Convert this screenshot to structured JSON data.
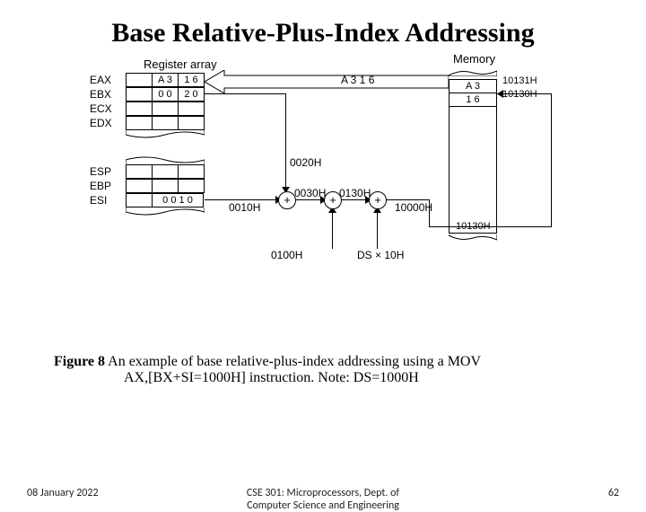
{
  "title": "Base Relative-Plus-Index Addressing",
  "diagram": {
    "register_array_label": "Register array",
    "memory_label": "Memory",
    "registers": {
      "names": [
        "EAX",
        "EBX",
        "ECX",
        "EDX",
        "ESP",
        "EBP",
        "ESI"
      ],
      "eax": [
        "A 3",
        "1 6"
      ],
      "ebx": [
        "0 0",
        "2 0"
      ],
      "esi": [
        "0 0 1 0"
      ]
    },
    "memory": {
      "cells": [
        "A 3",
        "1 6"
      ],
      "addrs": [
        "10131H",
        "10130H",
        "10130H"
      ]
    },
    "data_bus": "A 3 1 6",
    "wires": {
      "ebx_out": "0020H",
      "esi_out": "0010H",
      "disp": "0100H",
      "sum1": "0030H",
      "sum2": "0130H",
      "ds_calc": "DS × 10H",
      "ds_out": "10000H"
    }
  },
  "caption": {
    "figure_label": "Figure 8",
    "line1": "  An example of base relative-plus-index addressing using a MOV",
    "line2": "AX,[BX+SI=1000H] instruction. Note: DS=1000H"
  },
  "footer": {
    "date": "08 January 2022",
    "course_l1": "CSE 301: Microprocessors, Dept. of",
    "course_l2": "Computer Science and Engineering",
    "page": "62"
  }
}
